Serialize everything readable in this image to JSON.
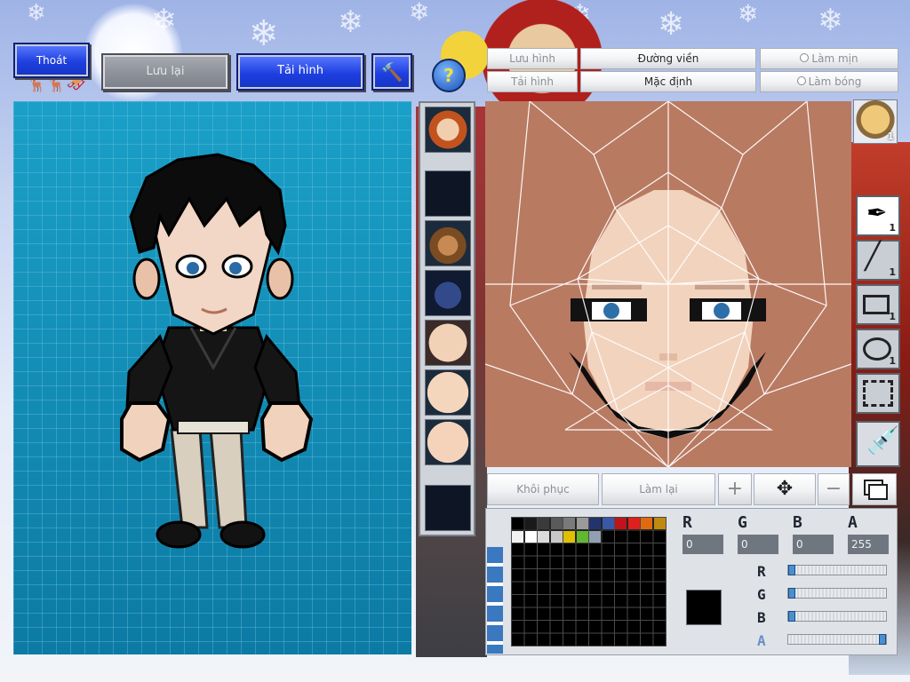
{
  "top_left_buttons": {
    "exit_label": "Thoát",
    "save_label": "Lưu lại",
    "reload_label": "Tải hình"
  },
  "editor_toolbar": {
    "save_image_label": "Lưu hình",
    "load_image_label": "Tải hình",
    "outline_label": "Đường viền",
    "default_label": "Mặc định",
    "smooth_label": "Làm mịn",
    "shine_label": "Làm bóng",
    "help_label": "?"
  },
  "bottom_toolbar": {
    "restore_label": "Khôi phục",
    "redo_label": "Làm lại"
  },
  "tools": [
    {
      "name": "pen",
      "count": "1"
    },
    {
      "name": "line",
      "count": "1"
    },
    {
      "name": "rectangle",
      "count": "1"
    },
    {
      "name": "ellipse",
      "count": "1"
    },
    {
      "name": "select",
      "count": ""
    },
    {
      "name": "eyedropper",
      "count": ""
    }
  ],
  "character_badge_count": "1",
  "color": {
    "r_label": "R",
    "g_label": "G",
    "b_label": "B",
    "a_label": "A",
    "r_value": "0",
    "g_value": "0",
    "b_value": "0",
    "a_value": "255",
    "current_color": "#000000"
  },
  "palette_colors": [
    "#000000",
    "#1a1a1a",
    "#3a3a3a",
    "#5a5a5a",
    "#7a7a7a",
    "#9a9a9a",
    "#21346e",
    "#3b57a8",
    "#c0141c",
    "#e0201c",
    "#e06a10",
    "#c08a10",
    "#f2f2f2",
    "#ffffff",
    "#dcdcdc",
    "#c8c8c8",
    "#e0c000",
    "#60b830",
    "#90a0b0"
  ]
}
